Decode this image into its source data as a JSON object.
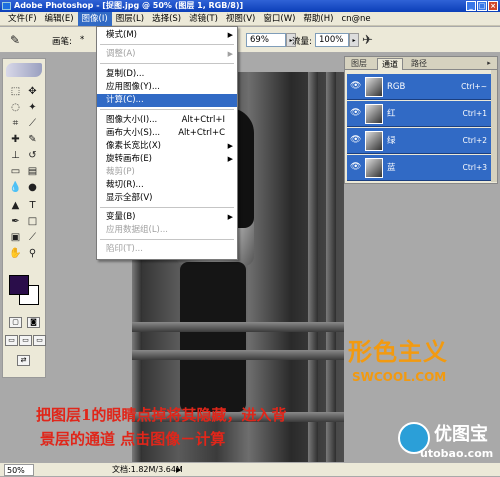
{
  "title": "Adobe Photoshop - [捉图.jpg @ 50% (图层 1, RGB/8)]",
  "menubar": [
    "文件(F)",
    "编辑(E)",
    "图像(I)",
    "图层(L)",
    "选择(S)",
    "滤镜(T)",
    "视图(V)",
    "窗口(W)",
    "帮助(H)",
    "cn@ne"
  ],
  "options": {
    "brush_label": "画笔:",
    "brush_size": "*",
    "opacity_value": "69%",
    "flow_label": "流量:",
    "flow_value": "100%"
  },
  "image_menu": {
    "mode": "模式(M)",
    "adjust": "调整(A)",
    "duplicate": "复制(D)...",
    "apply_image": "应用图像(Y)...",
    "calculations": "计算(C)...",
    "image_size": "图像大小(I)...",
    "image_size_sc": "Alt+Ctrl+I",
    "canvas_size": "画布大小(S)...",
    "canvas_size_sc": "Alt+Ctrl+C",
    "pixel_aspect": "像素长宽比(X)",
    "rotate_canvas": "旋转画布(E)",
    "crop": "裁剪(P)",
    "trim": "裁切(R)...",
    "reveal_all": "显示全部(V)",
    "variables": "变量(B)",
    "apply_data_set": "应用数据组(L)...",
    "trap": "陷印(T)..."
  },
  "channels_panel": {
    "tabs": [
      "图层",
      "通道",
      "路径"
    ],
    "rows": [
      {
        "name": "RGB",
        "shortcut": "Ctrl+~"
      },
      {
        "name": "红",
        "shortcut": "Ctrl+1"
      },
      {
        "name": "绿",
        "shortcut": "Ctrl+2"
      },
      {
        "name": "蓝",
        "shortcut": "Ctrl+3"
      }
    ]
  },
  "watermark": {
    "logo": "形色主义",
    "url": "SWCOOL.COM"
  },
  "caption": {
    "line1": "把图层1的眼睛点掉将其隐藏，进入背",
    "line2": "景层的通道 点击图像－计算"
  },
  "site": {
    "name": "优图宝",
    "url": "utobao.com"
  },
  "status": {
    "zoom": "50%",
    "doc": "文档:1.82M/3.64M"
  },
  "colors": {
    "foreground": "#2a0d4a",
    "background": "#ffffff",
    "highlight": "#316ac5",
    "watermark": "#f29a10",
    "caption": "#e0261a"
  }
}
